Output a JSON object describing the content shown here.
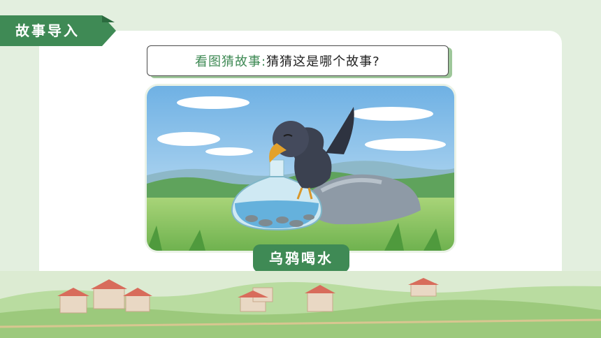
{
  "section_tag": "故事导入",
  "question": {
    "label": "看图猜故事:",
    "text": "猜猜这是哪个故事?"
  },
  "illustration": {
    "subject": "crow-drinking-from-bottle",
    "story_title": "乌鸦喝水"
  },
  "colors": {
    "accent_green": "#3f8a55",
    "background": "#e3efdf"
  }
}
